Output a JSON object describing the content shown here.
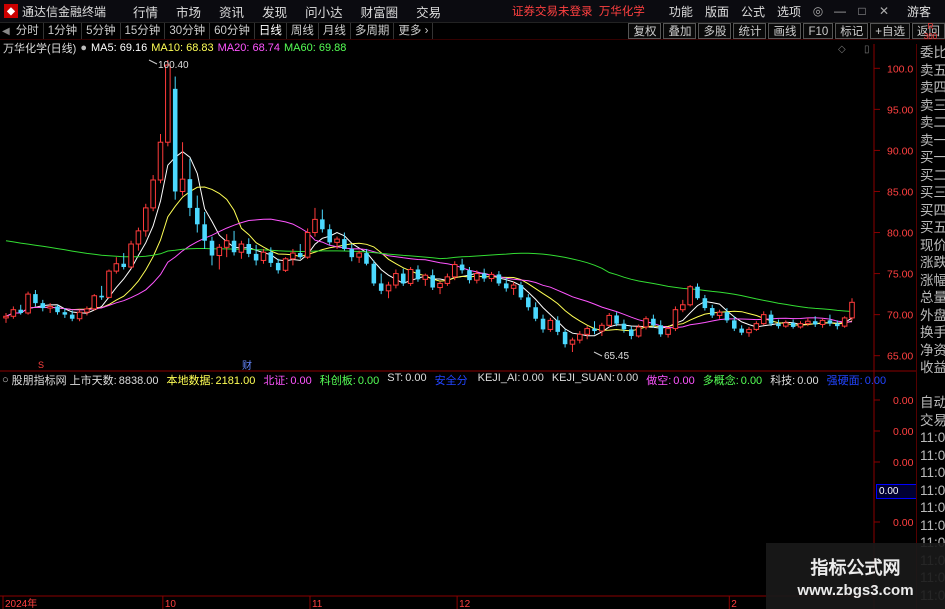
{
  "app": {
    "title": "通达信金融终端",
    "notice": "证券交易未登录",
    "stock_name": "万华化学"
  },
  "menu": [
    "行情",
    "市场",
    "资讯",
    "发现",
    "问小达",
    "财富圈",
    "交易"
  ],
  "titlebar_right": {
    "func": "功能",
    "layout": "版面",
    "formula": "公式",
    "options": "选项",
    "guest": "游客"
  },
  "period_tabs": [
    "分时",
    "1分钟",
    "5分钟",
    "15分钟",
    "30分钟",
    "60分钟",
    "日线",
    "周线",
    "月线",
    "多周期",
    "更多"
  ],
  "tools": [
    "复权",
    "叠加",
    "多股",
    "统计",
    "画线",
    "F10",
    "标记",
    "+自选",
    "返回"
  ],
  "info": {
    "name": "万华化学(日线)",
    "ma5": "MA5: 69.16",
    "ma10": "MA10: 68.83",
    "ma20": "MA20: 68.74",
    "ma60": "MA60: 69.88"
  },
  "rate": {
    "line1": "R",
    "line2": "300"
  },
  "indicator": {
    "name": "股朋指标网",
    "items": [
      {
        "label": "上市天数:",
        "value": "8838.00",
        "color": "#dddddd"
      },
      {
        "label": "本地数据:",
        "value": "2181.00",
        "color": "#ffff55"
      },
      {
        "label": "北证:",
        "value": "0.00",
        "color": "#ff55ff"
      },
      {
        "label": "科创板:",
        "value": "0.00",
        "color": "#55ff55"
      },
      {
        "label": "ST:",
        "value": "0.00",
        "color": "#dddddd"
      },
      {
        "label": "安全分",
        "value": "",
        "color": "#2244ff"
      },
      {
        "label": "KEJI_AI:",
        "value": "0.00",
        "color": "#dddddd"
      },
      {
        "label": "KEJI_SUAN:",
        "value": "0.00",
        "color": "#dddddd"
      },
      {
        "label": "做空:",
        "value": "0.00",
        "color": "#ff55ff"
      },
      {
        "label": "多概念:",
        "value": "0.00",
        "color": "#55ff55"
      },
      {
        "label": "科技:",
        "value": "0.00",
        "color": "#dddddd"
      },
      {
        "label": "强硬面:",
        "value": "0.00",
        "color": "#2244ff"
      }
    ]
  },
  "right_panel": [
    "委比",
    "卖五",
    "卖四",
    "卖三",
    "卖二",
    "卖一",
    "买一",
    "买二",
    "买三",
    "买四",
    "买五",
    "现价",
    "涨跌",
    "涨幅",
    "总量",
    "外盘",
    "换手",
    "净资",
    "收益",
    "",
    "自动",
    "交易",
    "11:08",
    "11:08",
    "11:08",
    "11:08",
    "11:08",
    "11:08",
    "11:08",
    "11:08",
    "11:08",
    "11:08"
  ],
  "price_axis": [
    "100.0",
    "95.00",
    "90.00",
    "85.00",
    "80.00",
    "75.00",
    "70.00",
    "65.00"
  ],
  "indicator_axis": [
    "0.00",
    "0.00",
    "0.00",
    "0.00",
    "0.00"
  ],
  "time_axis": [
    "2024年",
    "10",
    "11",
    "12",
    "2"
  ],
  "annotations": {
    "high": "100.40",
    "low": "65.45",
    "cai": "财",
    "s": "S"
  },
  "indicator_badge": "0.00",
  "watermark": {
    "line1": "指标公式网",
    "line2": "www.zbgs3.com"
  },
  "chart_data": {
    "type": "candlestick",
    "ylim": [
      63.5,
      101.5
    ],
    "ticks": [
      100,
      95,
      90,
      85,
      80,
      75,
      70,
      65
    ],
    "ohlc": [
      [
        69.6,
        70.2,
        69.0,
        69.8
      ],
      [
        69.8,
        71.0,
        69.5,
        70.6
      ],
      [
        70.6,
        71.2,
        70.0,
        70.2
      ],
      [
        70.2,
        72.8,
        70.0,
        72.5
      ],
      [
        72.5,
        73.0,
        71.0,
        71.4
      ],
      [
        71.4,
        71.8,
        70.4,
        70.8
      ],
      [
        70.8,
        71.4,
        70.2,
        71.0
      ],
      [
        71.0,
        71.2,
        70.0,
        70.3
      ],
      [
        70.3,
        70.8,
        69.6,
        70.0
      ],
      [
        70.0,
        70.5,
        69.2,
        69.5
      ],
      [
        69.5,
        70.6,
        69.2,
        70.3
      ],
      [
        70.3,
        71.0,
        69.9,
        70.7
      ],
      [
        70.7,
        72.5,
        70.5,
        72.3
      ],
      [
        72.3,
        73.5,
        71.8,
        72.1
      ],
      [
        72.1,
        75.5,
        72.0,
        75.3
      ],
      [
        75.3,
        77.0,
        75.0,
        76.2
      ],
      [
        76.2,
        77.5,
        75.5,
        75.8
      ],
      [
        75.8,
        79.0,
        75.6,
        78.6
      ],
      [
        78.6,
        80.6,
        77.8,
        80.2
      ],
      [
        80.2,
        83.5,
        79.5,
        83.0
      ],
      [
        83.0,
        87.0,
        82.6,
        86.4
      ],
      [
        86.4,
        92.0,
        86.0,
        91.0
      ],
      [
        91.0,
        101.0,
        90.5,
        100.4
      ],
      [
        97.5,
        99.0,
        84.0,
        85.0
      ],
      [
        85.0,
        91.0,
        84.5,
        86.5
      ],
      [
        86.5,
        89.0,
        82.0,
        83.0
      ],
      [
        83.0,
        84.5,
        80.0,
        81.0
      ],
      [
        81.0,
        82.5,
        78.0,
        79.0
      ],
      [
        79.0,
        79.5,
        76.0,
        77.2
      ],
      [
        77.2,
        78.6,
        75.5,
        78.2
      ],
      [
        78.2,
        79.8,
        77.0,
        79.0
      ],
      [
        79.0,
        80.2,
        77.2,
        77.6
      ],
      [
        77.6,
        79.0,
        76.8,
        78.6
      ],
      [
        78.6,
        79.3,
        77.0,
        77.4
      ],
      [
        77.4,
        78.5,
        76.0,
        76.6
      ],
      [
        76.6,
        78.0,
        76.2,
        77.6
      ],
      [
        77.6,
        78.2,
        75.8,
        76.3
      ],
      [
        76.3,
        76.8,
        75.0,
        75.4
      ],
      [
        75.4,
        77.0,
        75.2,
        76.8
      ],
      [
        76.8,
        78.0,
        76.0,
        77.5
      ],
      [
        77.5,
        78.6,
        76.8,
        77.0
      ],
      [
        77.0,
        80.5,
        76.8,
        80.0
      ],
      [
        80.0,
        83.0,
        79.5,
        81.6
      ],
      [
        81.6,
        82.8,
        80.0,
        80.4
      ],
      [
        80.4,
        81.0,
        78.5,
        78.8
      ],
      [
        78.8,
        79.5,
        78.0,
        79.2
      ],
      [
        79.2,
        80.0,
        77.8,
        78.0
      ],
      [
        78.0,
        78.6,
        76.5,
        77.0
      ],
      [
        77.0,
        77.8,
        76.3,
        77.5
      ],
      [
        77.5,
        78.0,
        76.0,
        76.2
      ],
      [
        76.2,
        76.6,
        73.5,
        73.8
      ],
      [
        73.8,
        75.0,
        72.5,
        72.9
      ],
      [
        72.9,
        74.0,
        72.0,
        73.6
      ],
      [
        73.6,
        75.5,
        73.2,
        75.0
      ],
      [
        75.0,
        75.6,
        73.5,
        73.8
      ],
      [
        73.8,
        75.8,
        73.5,
        75.5
      ],
      [
        75.5,
        76.0,
        74.0,
        74.3
      ],
      [
        74.3,
        75.0,
        73.5,
        74.8
      ],
      [
        74.8,
        75.5,
        73.0,
        73.3
      ],
      [
        73.3,
        74.0,
        72.5,
        73.8
      ],
      [
        73.8,
        75.0,
        73.5,
        74.6
      ],
      [
        74.6,
        76.5,
        74.2,
        76.1
      ],
      [
        76.1,
        76.8,
        75.0,
        75.4
      ],
      [
        75.4,
        75.8,
        73.8,
        74.2
      ],
      [
        74.2,
        75.4,
        73.8,
        75.0
      ],
      [
        75.0,
        75.6,
        74.0,
        74.4
      ],
      [
        74.4,
        75.2,
        74.0,
        74.9
      ],
      [
        74.9,
        75.3,
        73.5,
        73.8
      ],
      [
        73.8,
        74.5,
        72.8,
        73.2
      ],
      [
        73.2,
        74.0,
        72.4,
        73.6
      ],
      [
        73.6,
        74.0,
        71.8,
        72.1
      ],
      [
        72.1,
        72.5,
        70.5,
        70.9
      ],
      [
        70.9,
        71.5,
        69.2,
        69.5
      ],
      [
        69.5,
        70.0,
        67.8,
        68.2
      ],
      [
        68.2,
        69.6,
        67.9,
        69.3
      ],
      [
        69.3,
        69.8,
        67.5,
        67.9
      ],
      [
        67.9,
        68.2,
        66.0,
        66.4
      ],
      [
        66.4,
        67.2,
        65.45,
        66.9
      ],
      [
        66.9,
        68.0,
        66.5,
        67.6
      ],
      [
        67.6,
        68.6,
        67.0,
        68.3
      ],
      [
        68.3,
        69.2,
        67.6,
        68.0
      ],
      [
        68.0,
        69.0,
        67.4,
        68.7
      ],
      [
        68.7,
        70.2,
        68.5,
        69.9
      ],
      [
        69.9,
        70.3,
        68.6,
        68.9
      ],
      [
        68.9,
        69.4,
        67.8,
        68.2
      ],
      [
        68.2,
        68.6,
        67.0,
        67.4
      ],
      [
        67.4,
        68.8,
        67.2,
        68.5
      ],
      [
        68.5,
        69.8,
        68.2,
        69.5
      ],
      [
        69.5,
        70.0,
        68.4,
        68.7
      ],
      [
        68.7,
        69.3,
        67.3,
        67.6
      ],
      [
        67.6,
        68.5,
        67.2,
        68.3
      ],
      [
        68.3,
        71.0,
        68.0,
        70.6
      ],
      [
        70.6,
        71.8,
        70.3,
        71.2
      ],
      [
        71.2,
        73.6,
        71.0,
        73.4
      ],
      [
        73.4,
        73.8,
        71.8,
        72.0
      ],
      [
        72.0,
        72.4,
        70.5,
        70.8
      ],
      [
        70.8,
        71.2,
        69.6,
        69.9
      ],
      [
        69.9,
        70.6,
        69.5,
        70.3
      ],
      [
        70.3,
        70.8,
        69.0,
        69.3
      ],
      [
        69.3,
        69.8,
        68.0,
        68.3
      ],
      [
        68.3,
        68.7,
        67.5,
        67.8
      ],
      [
        67.8,
        68.5,
        67.3,
        68.2
      ],
      [
        68.2,
        69.2,
        68.0,
        68.9
      ],
      [
        68.9,
        70.4,
        68.7,
        70.0
      ],
      [
        70.0,
        70.5,
        68.6,
        68.9
      ],
      [
        68.9,
        69.4,
        68.3,
        68.6
      ],
      [
        68.6,
        69.3,
        68.4,
        69.0
      ],
      [
        69.0,
        69.4,
        68.3,
        68.5
      ],
      [
        68.5,
        69.2,
        68.3,
        68.9
      ],
      [
        68.9,
        69.6,
        68.6,
        69.2
      ],
      [
        69.2,
        69.8,
        68.5,
        68.8
      ],
      [
        68.8,
        69.5,
        68.4,
        69.3
      ],
      [
        69.3,
        70.0,
        68.6,
        68.9
      ],
      [
        68.9,
        69.3,
        68.2,
        68.6
      ],
      [
        68.6,
        69.8,
        68.4,
        69.6
      ],
      [
        69.6,
        72.0,
        69.3,
        71.5
      ]
    ]
  }
}
